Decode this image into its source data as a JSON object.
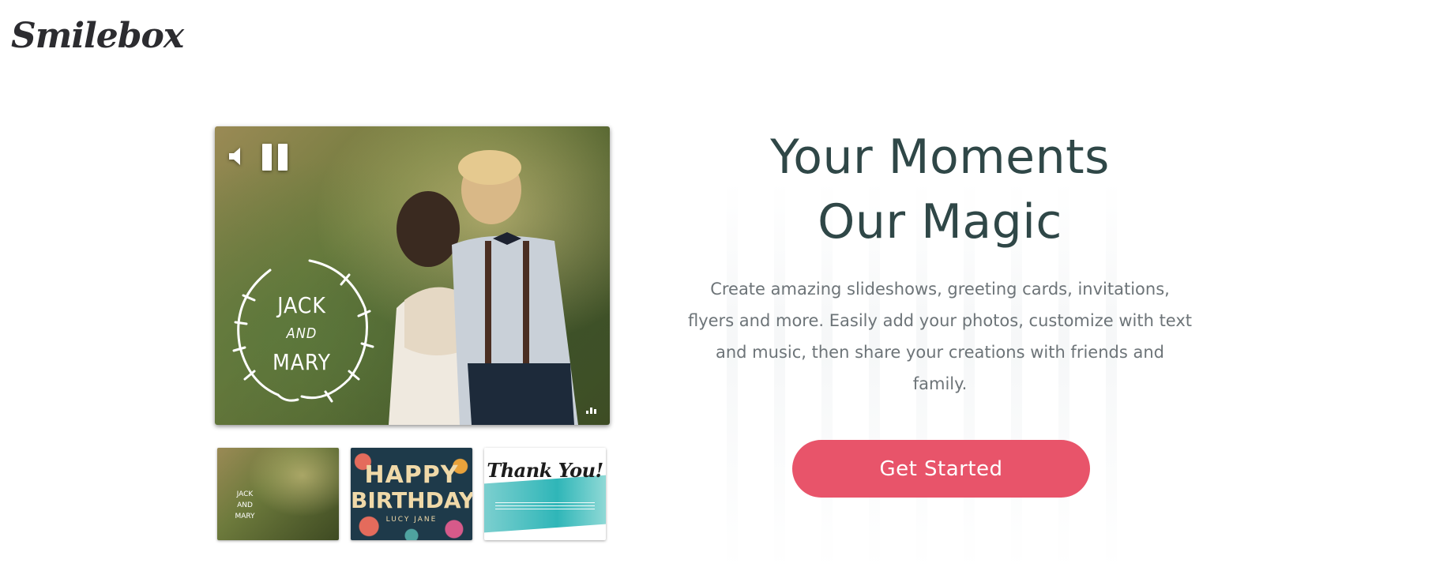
{
  "header": {
    "logo_text": "Smilebox"
  },
  "hero_media": {
    "controls": {
      "sound_icon": "speaker-icon",
      "pause_icon": "pause-icon",
      "stats_icon": "bar-chart-icon"
    },
    "overlay": {
      "line1": "JACK",
      "line2": "AND",
      "line3": "MARY"
    }
  },
  "thumbnails": [
    {
      "name": "wedding",
      "lines": [
        "JACK",
        "AND",
        "MARY"
      ]
    },
    {
      "name": "birthday",
      "line1": "HAPPY",
      "line2": "BIRTHDAY",
      "line3": "LUCY JANE"
    },
    {
      "name": "thank-you",
      "line1": "Thank You!"
    }
  ],
  "hero_text": {
    "headline_line1": "Your Moments",
    "headline_line2": "Our Magic",
    "description": "Create amazing slideshows, greeting cards, invitations, flyers and more. Easily add your photos, customize with text and music, then share your creations with friends and family.",
    "cta_label": "Get Started"
  },
  "colors": {
    "accent": "#e8546a",
    "headline": "#2f4747",
    "body_text": "#6d7478",
    "logo": "#2c2c30"
  }
}
